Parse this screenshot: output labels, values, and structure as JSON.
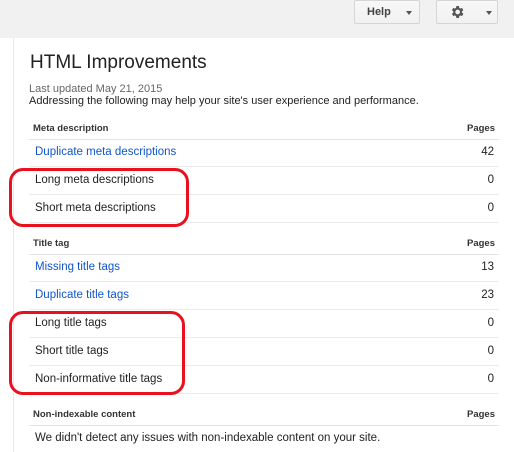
{
  "toolbar": {
    "help_label": "Help",
    "help_icon": "chevron-down-icon",
    "settings_icon": "gear-icon"
  },
  "page": {
    "title": "HTML Improvements",
    "last_updated": "Last updated May 21, 2015",
    "subtitle": "Addressing the following may help your site's user experience and performance."
  },
  "sections": {
    "meta": {
      "header": "Meta description",
      "pages_header": "Pages",
      "rows": [
        {
          "label": "Duplicate meta descriptions",
          "count": "42",
          "is_link": true
        },
        {
          "label": "Long meta descriptions",
          "count": "0",
          "is_link": false
        },
        {
          "label": "Short meta descriptions",
          "count": "0",
          "is_link": false
        }
      ]
    },
    "title_tag": {
      "header": "Title tag",
      "pages_header": "Pages",
      "rows": [
        {
          "label": "Missing title tags",
          "count": "13",
          "is_link": true
        },
        {
          "label": "Duplicate title tags",
          "count": "23",
          "is_link": true
        },
        {
          "label": "Long title tags",
          "count": "0",
          "is_link": false
        },
        {
          "label": "Short title tags",
          "count": "0",
          "is_link": false
        },
        {
          "label": "Non-informative title tags",
          "count": "0",
          "is_link": false
        }
      ]
    },
    "non_indexable": {
      "header": "Non-indexable content",
      "pages_header": "Pages",
      "message": "We didn't detect any issues with non-indexable content on your site."
    }
  },
  "colors": {
    "link": "#1155cc",
    "highlight": "#e8111d",
    "text": "#222222"
  }
}
